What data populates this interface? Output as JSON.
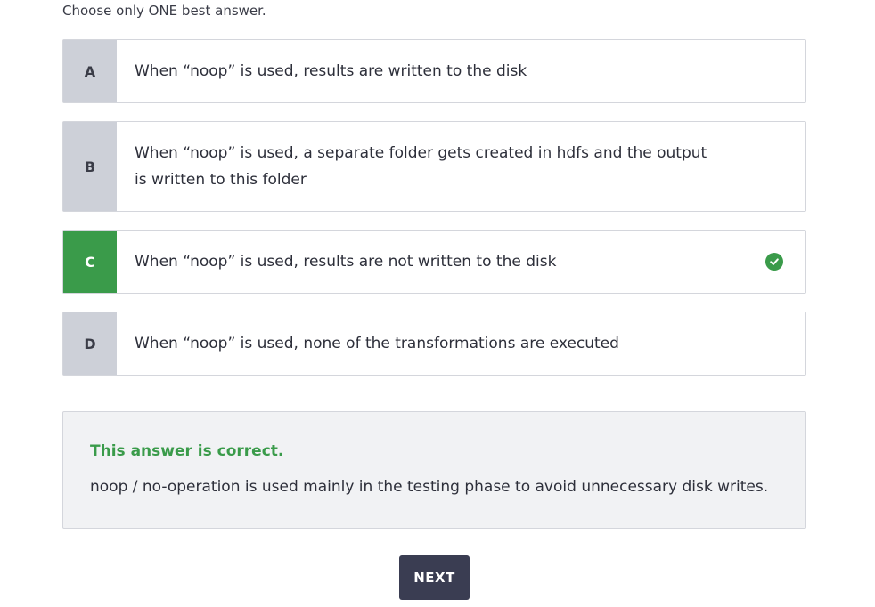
{
  "instruction": "Choose only ONE best answer.",
  "options": [
    {
      "letter": "A",
      "text": "When “noop” is used, results are written to the disk",
      "correct": false
    },
    {
      "letter": "B",
      "text": "When “noop” is used, a separate folder gets created in hdfs and the output is written to this folder",
      "correct": false
    },
    {
      "letter": "C",
      "text": "When “noop” is used, results are not written to the disk",
      "correct": true
    },
    {
      "letter": "D",
      "text": "When “noop” is used, none of the transformations are executed",
      "correct": false
    }
  ],
  "feedback": {
    "verdict": "This answer is correct.",
    "explanation": "noop / no-operation is used mainly in the testing phase to avoid unnecessary disk writes."
  },
  "next_label": "NEXT",
  "colors": {
    "correct": "#3a9b4a",
    "letter_bg": "#cdd0d8",
    "button_bg": "#3a3d52",
    "feedback_bg": "#f1f2f4"
  },
  "icons": {
    "correct_marker": "check-circle-icon"
  }
}
